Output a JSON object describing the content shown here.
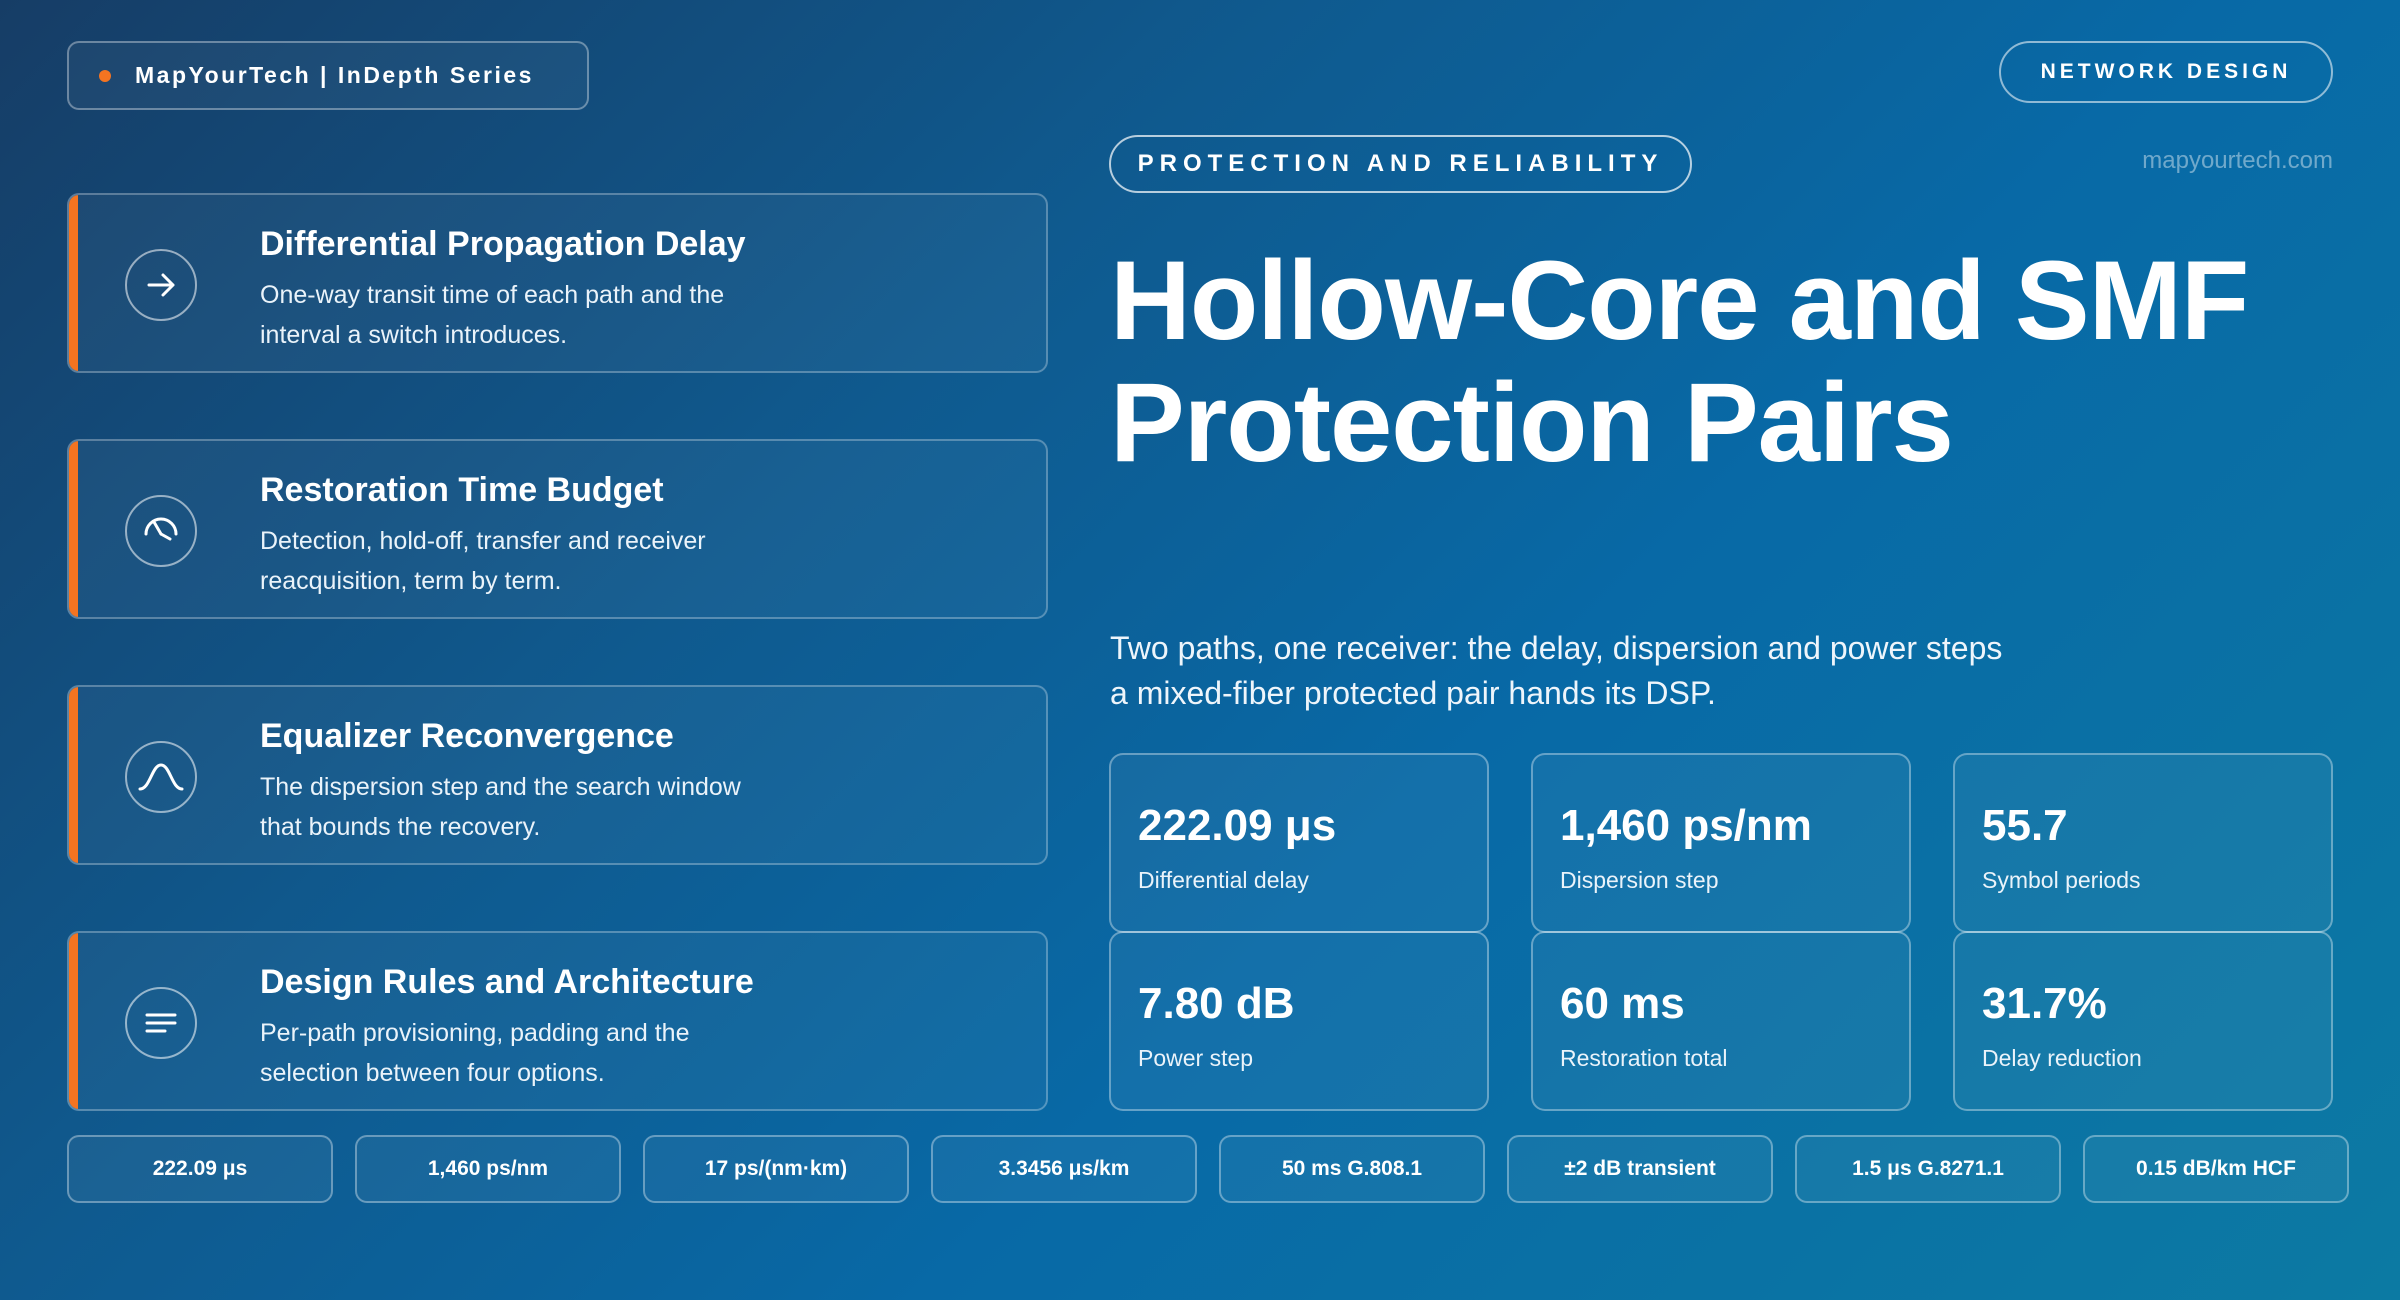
{
  "header": {
    "brand": "MapYourTech | InDepth Series",
    "category": "NETWORK DESIGN",
    "section": "PROTECTION AND RELIABILITY",
    "site": "mapyourtech.com"
  },
  "hero": {
    "title": "Hollow-Core and SMF Protection Pairs",
    "subtitle": "Two paths, one receiver: the delay, dispersion and power steps a mixed-fiber protected pair hands its DSP."
  },
  "cards": [
    {
      "title": "Differential Propagation Delay",
      "desc": "One-way transit time of each path and the interval a switch introduces.",
      "icon": "arrow-right-icon"
    },
    {
      "title": "Restoration Time Budget",
      "desc": "Detection, hold-off, transfer and receiver reacquisition, term by term.",
      "icon": "timer-icon"
    },
    {
      "title": "Equalizer Reconvergence",
      "desc": "The dispersion step and the search window that bounds the recovery.",
      "icon": "curve-icon"
    },
    {
      "title": "Design Rules and Architecture",
      "desc": "Per-path provisioning, padding and the selection between four options.",
      "icon": "list-icon"
    }
  ],
  "stats": [
    {
      "value": "222.09 μs",
      "label": "Differential delay"
    },
    {
      "value": "1,460 ps/nm",
      "label": "Dispersion step"
    },
    {
      "value": "55.7",
      "label": "Symbol periods"
    },
    {
      "value": "7.80 dB",
      "label": "Power step"
    },
    {
      "value": "60 ms",
      "label": "Restoration total"
    },
    {
      "value": "31.7%",
      "label": "Delay reduction"
    }
  ],
  "chips": [
    "222.09 μs",
    "1,460 ps/nm",
    "17 ps/(nm·km)",
    "3.3456 μs/km",
    "50 ms G.808.1",
    "±2 dB transient",
    "1.5 μs G.8271.1",
    "0.15 dB/km HCF"
  ],
  "colors": {
    "accent": "#f47421"
  }
}
